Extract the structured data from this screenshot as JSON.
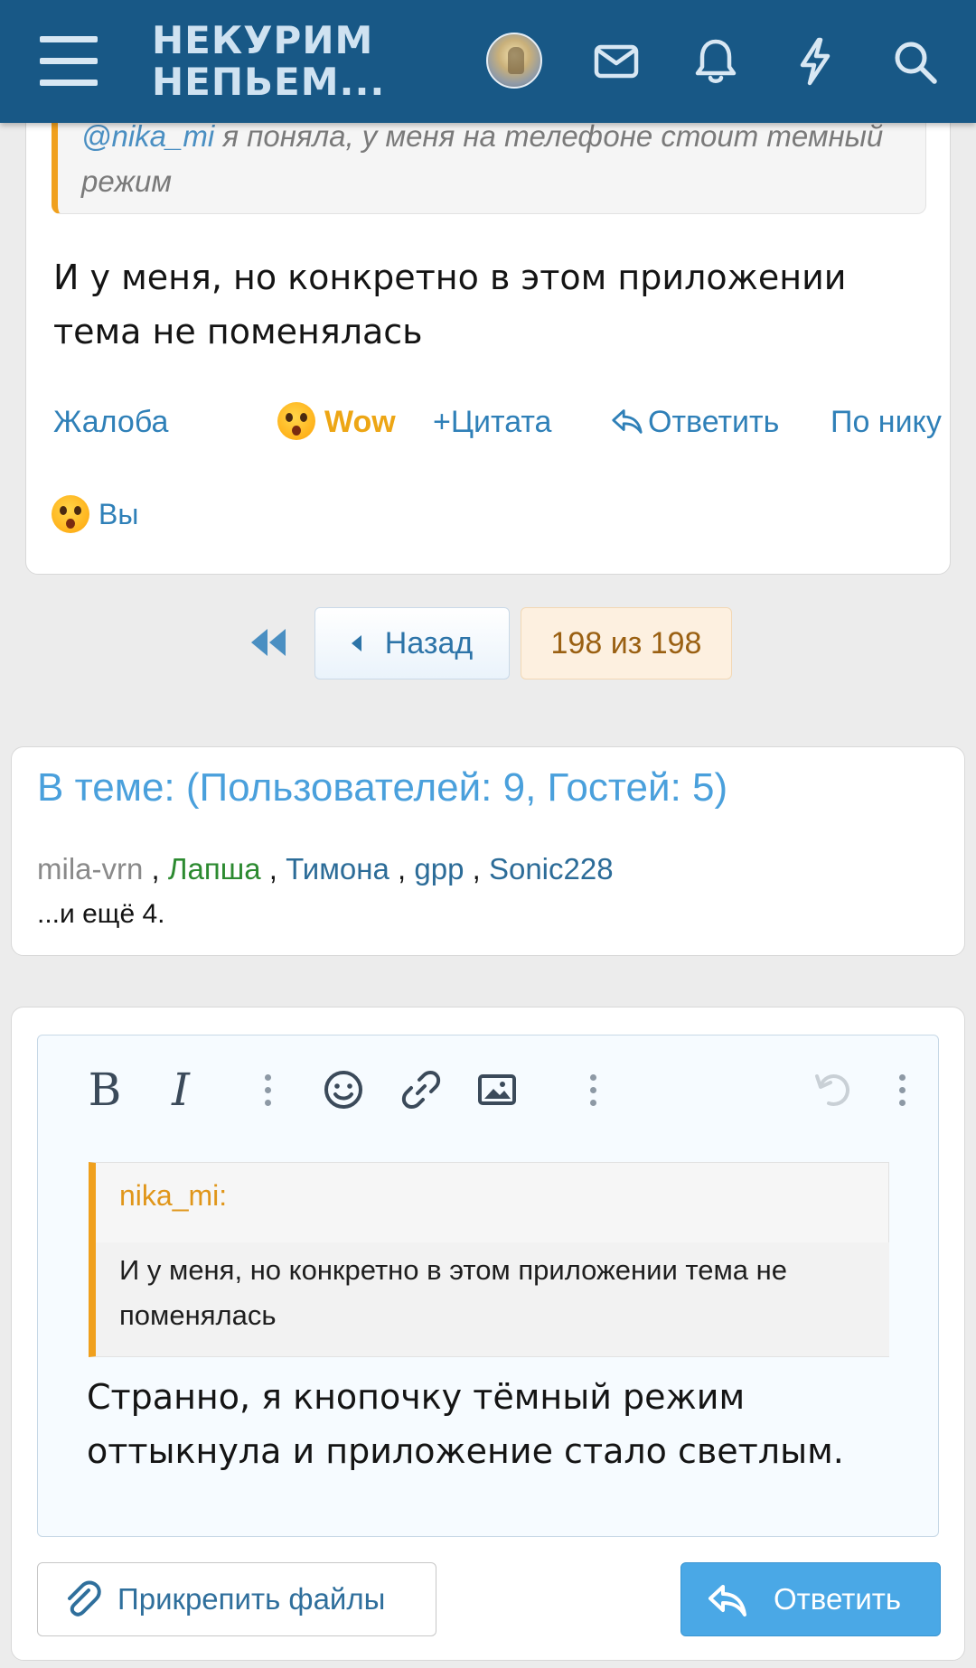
{
  "header": {
    "logo_line1": "НЕКУРИМ",
    "logo_line2": "НЕПЬЕМ...",
    "icons": [
      "menu-icon",
      "avatar",
      "mail-icon",
      "bell-icon",
      "lightning-icon",
      "search-icon"
    ],
    "background": "#185886"
  },
  "post": {
    "quote_mention": "@nika_mi",
    "quote_text": " я поняла, у меня на телефоне стоит темный режим",
    "body": "И у меня, но конкретно в этом приложении тема не поменялась",
    "actions": {
      "report": "Жалоба",
      "reaction": "Wow",
      "quote": "Цитата",
      "reply": "Ответить",
      "by_nick": "По нику"
    },
    "reaction_summary": "Вы"
  },
  "pagination": {
    "prev": "Назад",
    "current": "198 из 198"
  },
  "online": {
    "title": "В теме: (Пользователей: 9, Гостей: 5)",
    "users": [
      "mila-vrn",
      "Лапша",
      "Тимона",
      "gpp",
      "Sonic228"
    ],
    "separator": " , ",
    "more": "...и ещё 4."
  },
  "editor": {
    "toolbar": [
      "bold-icon",
      "italic-icon",
      "more-icon",
      "smiley-icon",
      "link-icon",
      "image-icon",
      "more-icon",
      "undo-icon",
      "more-icon"
    ],
    "bold_glyph": "B",
    "italic_glyph": "I",
    "quote_author": "nika_mi:",
    "quote_text": "И у меня, но конкретно в этом приложении тема не поменялась",
    "text": "Странно, я кнопочку тёмный режим оттыкнула и приложение стало светлым."
  },
  "buttons": {
    "attach": "Прикрепить файлы",
    "reply": "Ответить"
  },
  "colors": {
    "accent": "#2f80b8",
    "quote_bar": "#f0a01d",
    "reply_button": "#4aa8e6"
  }
}
